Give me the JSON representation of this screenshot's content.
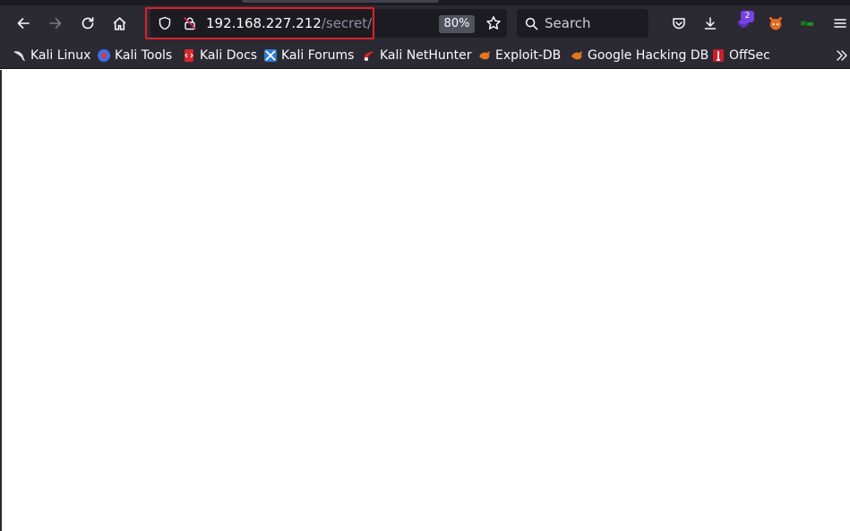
{
  "toolbar": {
    "back_icon": "arrow-left-icon",
    "forward_icon": "arrow-right-icon",
    "reload_icon": "reload-icon",
    "home_icon": "home-icon"
  },
  "address_bar": {
    "host": "192.168.227.212",
    "path": "/secret/",
    "zoom": "80%",
    "shield_icon": "shield-icon",
    "lock_icon": "insecure-lock-icon",
    "bookmark_star_icon": "star-icon"
  },
  "search": {
    "placeholder": "Search"
  },
  "toolbar_right": {
    "extension_badge": "2"
  },
  "bookmarks": [
    {
      "label": "Kali Linux"
    },
    {
      "label": "Kali Tools"
    },
    {
      "label": "Kali Docs"
    },
    {
      "label": "Kali Forums"
    },
    {
      "label": "Kali NetHunter"
    },
    {
      "label": "Exploit-DB"
    },
    {
      "label": "Google Hacking DB"
    },
    {
      "label": "OffSec"
    }
  ],
  "colors": {
    "toolbar_bg": "#2b2a33",
    "field_bg": "#1c1b22",
    "highlight": "#e0202a",
    "badge": "#7542e5"
  }
}
